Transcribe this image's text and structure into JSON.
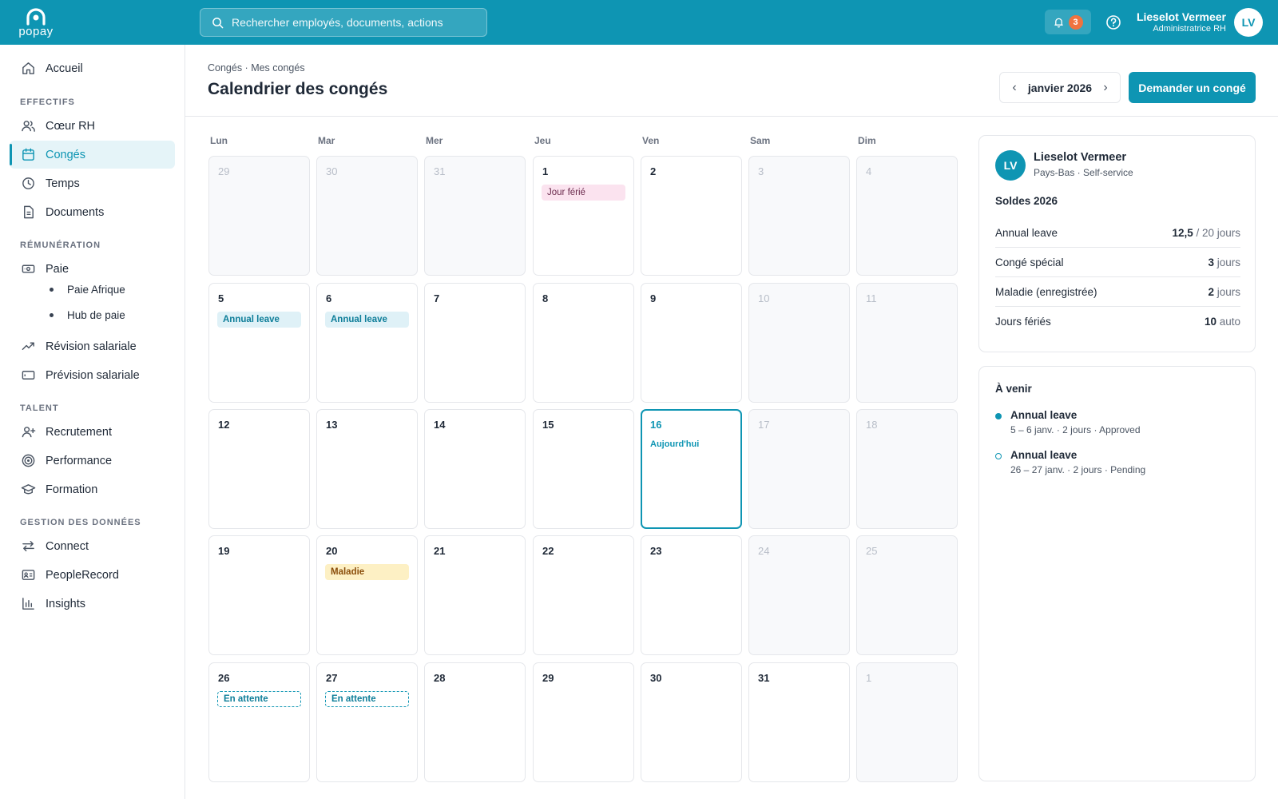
{
  "brand": {
    "logo_text": "popay",
    "accent": "#0e95b3",
    "badge_color": "#f0733f"
  },
  "search": {
    "placeholder": "Rechercher employés, documents, actions"
  },
  "topbar": {
    "notifications_count": "3",
    "user_name": "Lieselot Vermeer",
    "user_role": "Administratrice RH",
    "user_initials": "LV"
  },
  "sidebar": {
    "home": "Accueil",
    "sections": {
      "effectifs": "EFFECTIFS",
      "remuneration": "RÉMUNÉRATION",
      "talent": "TALENT",
      "donnees": "GESTION DES DONNÉES"
    },
    "items": {
      "coeur_rh": "Cœur RH",
      "conges": "Congés",
      "temps": "Temps",
      "documents": "Documents",
      "paie": "Paie",
      "paie_afrique": "Paie Afrique",
      "hub_de_paie": "Hub de paie",
      "revision": "Révision salariale",
      "prevision": "Prévision salariale",
      "recrutement": "Recrutement",
      "performance": "Performance",
      "formation": "Formation",
      "connect": "Connect",
      "peoplerecord": "PeopleRecord",
      "insights": "Insights"
    },
    "active": "conges"
  },
  "header": {
    "breadcrumb": "Congés · Mes congés",
    "title": "Calendrier des congés",
    "month": "janvier 2026",
    "request_button": "Demander un congé"
  },
  "calendar": {
    "weekdays": [
      "Lun",
      "Mar",
      "Mer",
      "Jeu",
      "Ven",
      "Sam",
      "Dim"
    ],
    "today_label": "Aujourd'hui",
    "weeks": [
      [
        {
          "day": "29",
          "muted": true
        },
        {
          "day": "30",
          "muted": true
        },
        {
          "day": "31",
          "muted": true
        },
        {
          "day": "1",
          "event": {
            "label": "Jour férié",
            "kind": "holiday"
          }
        },
        {
          "day": "2"
        },
        {
          "day": "3",
          "muted": true
        },
        {
          "day": "4",
          "muted": true
        }
      ],
      [
        {
          "day": "5",
          "event": {
            "label": "Annual leave",
            "kind": "leave"
          }
        },
        {
          "day": "6",
          "event": {
            "label": "Annual leave",
            "kind": "leave"
          }
        },
        {
          "day": "7"
        },
        {
          "day": "8"
        },
        {
          "day": "9"
        },
        {
          "day": "10",
          "muted": true
        },
        {
          "day": "11",
          "muted": true
        }
      ],
      [
        {
          "day": "12"
        },
        {
          "day": "13"
        },
        {
          "day": "14"
        },
        {
          "day": "15"
        },
        {
          "day": "16",
          "today": true
        },
        {
          "day": "17",
          "muted": true
        },
        {
          "day": "18",
          "muted": true
        }
      ],
      [
        {
          "day": "19"
        },
        {
          "day": "20",
          "event": {
            "label": "Maladie",
            "kind": "sick"
          }
        },
        {
          "day": "21"
        },
        {
          "day": "22"
        },
        {
          "day": "23"
        },
        {
          "day": "24",
          "muted": true
        },
        {
          "day": "25",
          "muted": true
        }
      ],
      [
        {
          "day": "26",
          "event": {
            "label": "En attente",
            "kind": "pending"
          }
        },
        {
          "day": "27",
          "event": {
            "label": "En attente",
            "kind": "pending"
          }
        },
        {
          "day": "28"
        },
        {
          "day": "29"
        },
        {
          "day": "30"
        },
        {
          "day": "31"
        },
        {
          "day": "1",
          "muted": true
        }
      ]
    ]
  },
  "employee": {
    "initials": "LV",
    "name": "Lieselot Vermeer",
    "meta": "Pays-Bas · Self-service"
  },
  "balances": {
    "title": "Soldes 2026",
    "rows": [
      {
        "label": "Annual leave",
        "value": "12,5",
        "unit": " / 20 jours"
      },
      {
        "label": "Congé spécial",
        "value": "3",
        "unit": " jours"
      },
      {
        "label": "Maladie (enregistrée)",
        "value": "2",
        "unit": " jours"
      },
      {
        "label": "Jours fériés",
        "value": "10",
        "unit": " auto"
      }
    ]
  },
  "upcoming": {
    "title": "À venir",
    "items": [
      {
        "title": "Annual leave",
        "detail": "5 – 6 janv. · 2 jours · Approved",
        "status": "approved"
      },
      {
        "title": "Annual leave",
        "detail": "26 – 27 janv. · 2 jours · Pending",
        "status": "pending"
      }
    ]
  }
}
